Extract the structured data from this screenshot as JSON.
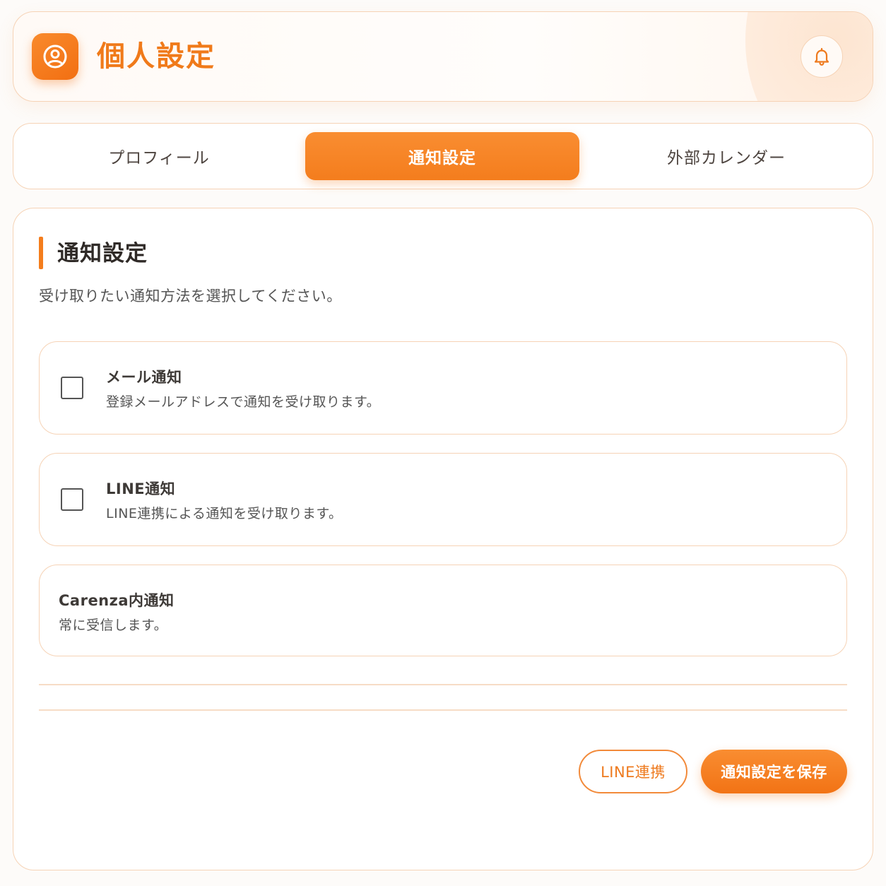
{
  "header": {
    "title": "個人設定",
    "app_icon": "user-circle-icon",
    "notification_icon": "bell-icon"
  },
  "tabs": [
    {
      "label": "プロフィール",
      "active": false
    },
    {
      "label": "通知設定",
      "active": true
    },
    {
      "label": "外部カレンダー",
      "active": false
    }
  ],
  "section": {
    "title": "通知設定",
    "description": "受け取りたい通知方法を選択してください。"
  },
  "options": [
    {
      "title": "メール通知",
      "description": "登録メールアドレスで通知を受け取ります。",
      "checked": false
    },
    {
      "title": "LINE通知",
      "description": "LINE連携による通知を受け取ります。",
      "checked": false
    },
    {
      "title": "Carenza内通知",
      "description": "常に受信します。"
    }
  ],
  "actions": {
    "line_link_label": "LINE連携",
    "save_label": "通知設定を保存"
  },
  "colors": {
    "accent": "#f47d1d",
    "border": "#f6d3b6",
    "text": "#4a4a4a"
  }
}
